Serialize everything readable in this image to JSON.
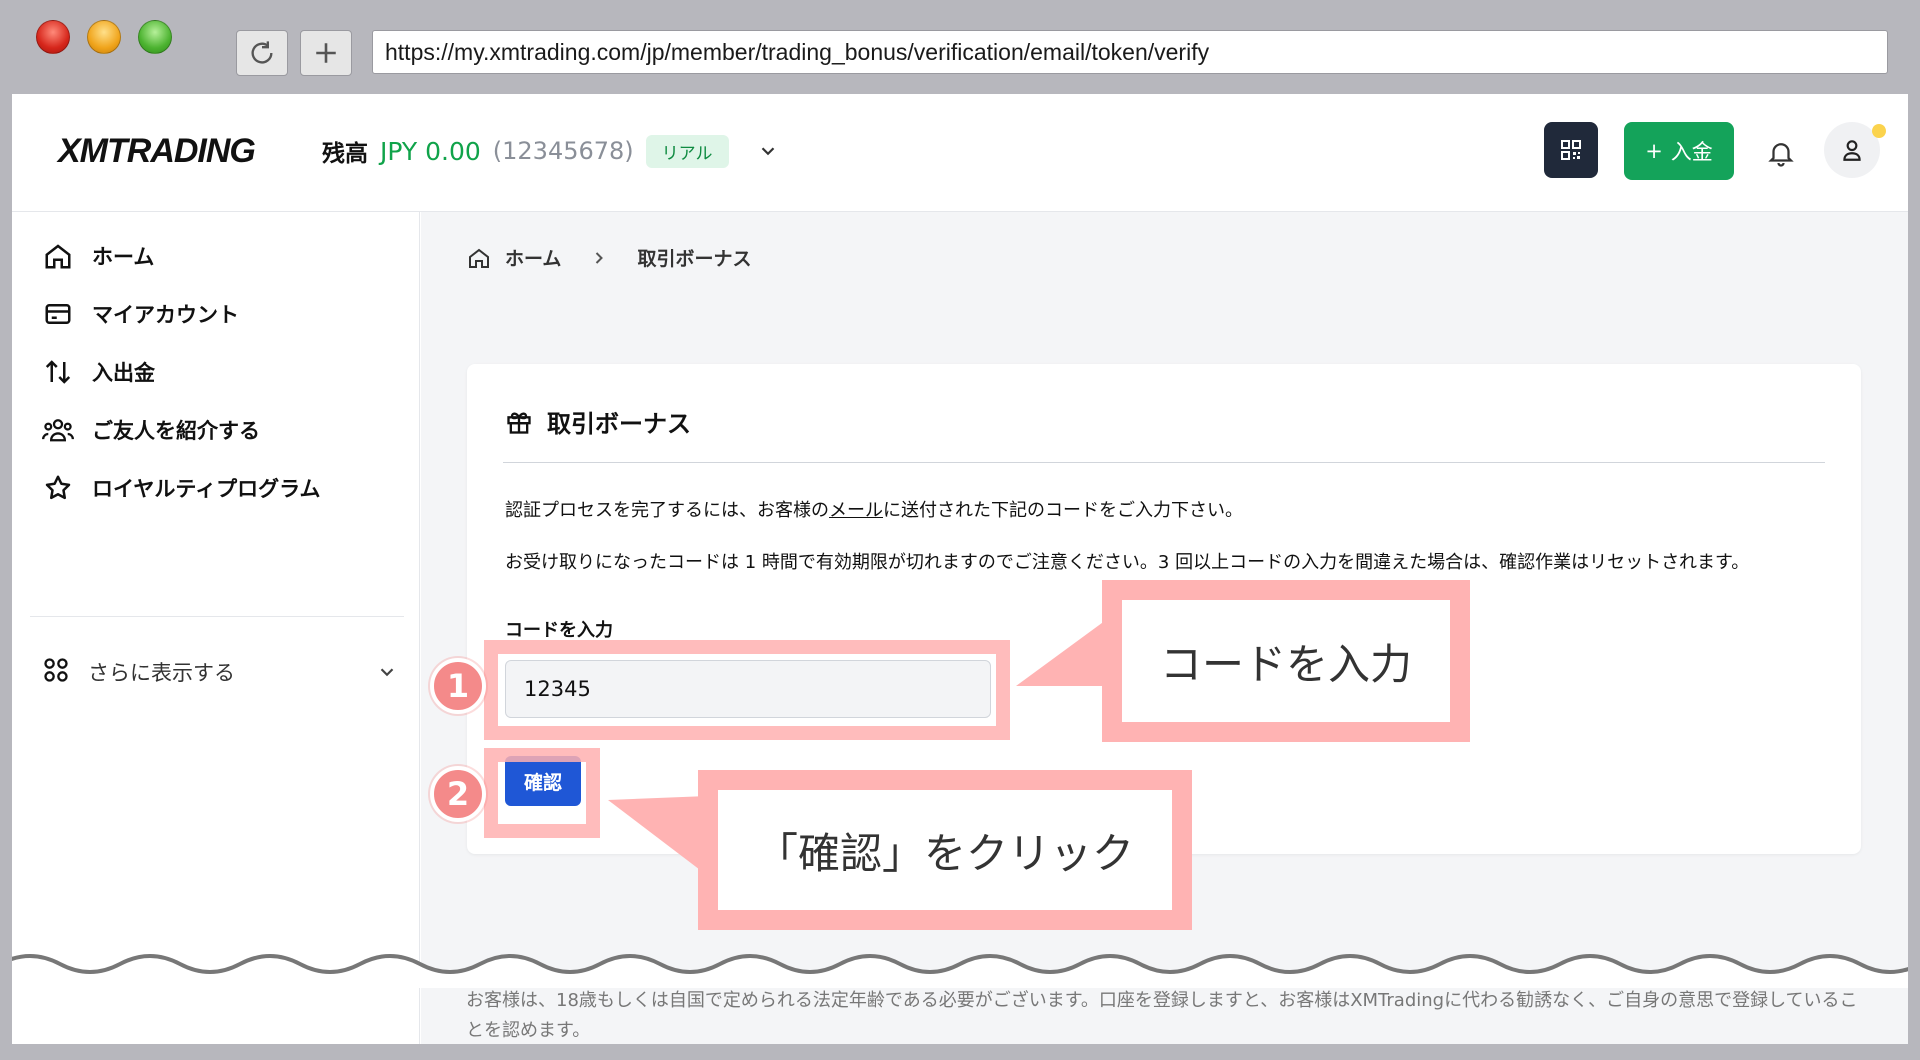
{
  "browser": {
    "url": "https://my.xmtrading.com/jp/member/trading_bonus/verification/email/token/verify"
  },
  "header": {
    "logo_text": "XMTRADING",
    "balance_label": "残高",
    "balance_amount": "JPY 0.00",
    "account_number": "(12345678)",
    "account_type": "リアル",
    "deposit_label": "入金",
    "deposit_plus": "+"
  },
  "sidebar": {
    "items": [
      {
        "label": "ホーム",
        "icon": "home-icon"
      },
      {
        "label": "マイアカウント",
        "icon": "card-icon"
      },
      {
        "label": "入出金",
        "icon": "transfer-icon"
      },
      {
        "label": "ご友人を紹介する",
        "icon": "users-icon"
      },
      {
        "label": "ロイヤルティプログラム",
        "icon": "star-icon"
      }
    ],
    "more_label": "さらに表示する"
  },
  "breadcrumb": {
    "home": "ホーム",
    "current": "取引ボーナス"
  },
  "card": {
    "title": "取引ボーナス",
    "desc1_before": "認証プロセスを完了するには、お客様の",
    "desc1_link": "メール",
    "desc1_after": "に送付された下記のコードをご入力下さい。",
    "desc2": "お受け取りになったコードは 1 時間で有効期限が切れますのでご注意ください。3 回以上コードの入力を間違えた場合は、確認作業はリセットされます。",
    "code_label": "コードを入力",
    "code_value": "12345",
    "confirm_label": "確認"
  },
  "annotations": {
    "step1": "1",
    "step2": "2",
    "callout1": "コードを入力",
    "callout2": "「確認」をクリック"
  },
  "footer": {
    "text": "お客様は、18歳もしくは自国で定められる法定年齢である必要がございます。口座を登録しますと、お客様はXMTradingに代わる勧誘なく、ご自身の意思で登録していることを認めます。"
  },
  "colors": {
    "accent_green": "#14a35a",
    "primary_blue": "#1f57d6",
    "annotation_pink": "#ffb3b3"
  }
}
